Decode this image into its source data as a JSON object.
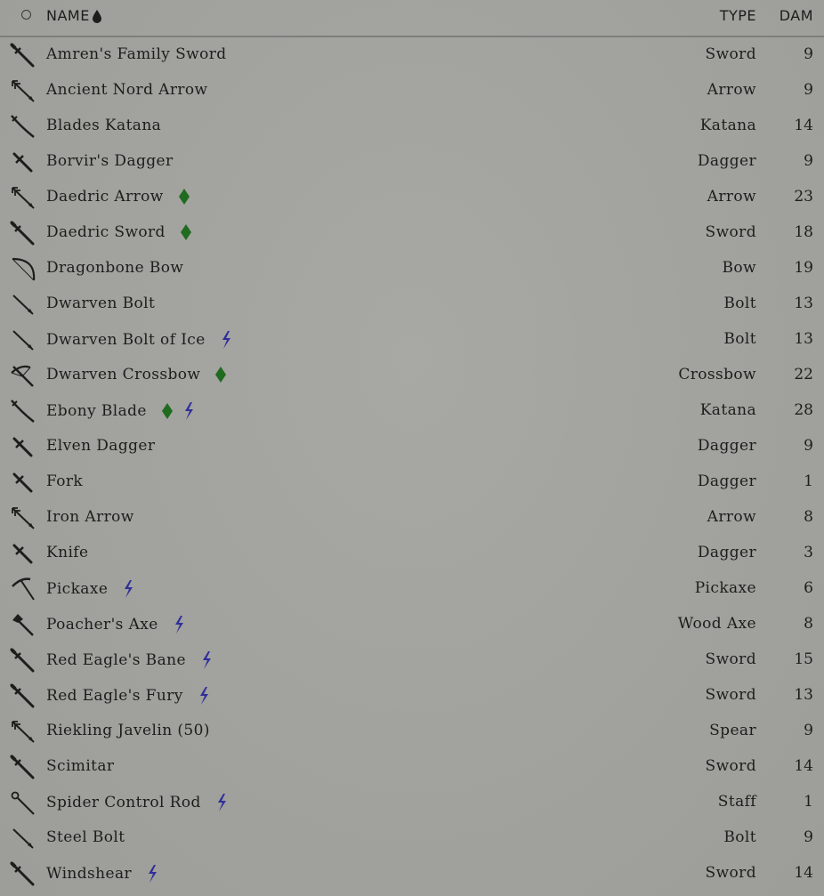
{
  "header": {
    "name_label": "NAME",
    "type_label": "TYPE",
    "dam_label": "DAM",
    "sort_indicator": "drop-sort-icon"
  },
  "colors": {
    "enchanted": "#2f2f9a",
    "stolen_marker": "#1f6b1f",
    "text": "#1d1d1b",
    "background": "#a3a39f"
  },
  "items": [
    {
      "name": "Amren's Family Sword",
      "type": "Sword",
      "dam": "9",
      "icon": "sword-icon",
      "badges": []
    },
    {
      "name": "Ancient Nord Arrow",
      "type": "Arrow",
      "dam": "9",
      "icon": "arrow-icon",
      "badges": []
    },
    {
      "name": "Blades Katana",
      "type": "Katana",
      "dam": "14",
      "icon": "katana-icon",
      "badges": []
    },
    {
      "name": "Borvir's Dagger",
      "type": "Dagger",
      "dam": "9",
      "icon": "dagger-icon",
      "badges": []
    },
    {
      "name": "Daedric Arrow",
      "type": "Arrow",
      "dam": "23",
      "icon": "arrow-icon",
      "badges": [
        "new-diamond-icon"
      ]
    },
    {
      "name": "Daedric Sword",
      "type": "Sword",
      "dam": "18",
      "icon": "sword-icon",
      "badges": [
        "new-diamond-icon"
      ]
    },
    {
      "name": "Dragonbone Bow",
      "type": "Bow",
      "dam": "19",
      "icon": "bow-icon",
      "badges": []
    },
    {
      "name": "Dwarven Bolt",
      "type": "Bolt",
      "dam": "13",
      "icon": "bolt-icon",
      "badges": []
    },
    {
      "name": "Dwarven Bolt of Ice",
      "type": "Bolt",
      "dam": "13",
      "icon": "bolt-icon",
      "badges": [
        "enchanted-icon"
      ]
    },
    {
      "name": "Dwarven Crossbow",
      "type": "Crossbow",
      "dam": "22",
      "icon": "crossbow-icon",
      "badges": [
        "new-diamond-icon"
      ]
    },
    {
      "name": "Ebony Blade",
      "type": "Katana",
      "dam": "28",
      "icon": "katana-icon",
      "badges": [
        "new-diamond-icon",
        "enchanted-icon"
      ]
    },
    {
      "name": "Elven Dagger",
      "type": "Dagger",
      "dam": "9",
      "icon": "dagger-icon",
      "badges": []
    },
    {
      "name": "Fork",
      "type": "Dagger",
      "dam": "1",
      "icon": "dagger-icon",
      "badges": []
    },
    {
      "name": "Iron Arrow",
      "type": "Arrow",
      "dam": "8",
      "icon": "arrow-icon",
      "badges": []
    },
    {
      "name": "Knife",
      "type": "Dagger",
      "dam": "3",
      "icon": "dagger-icon",
      "badges": []
    },
    {
      "name": "Pickaxe",
      "type": "Pickaxe",
      "dam": "6",
      "icon": "pickaxe-icon",
      "badges": [
        "enchanted-icon"
      ]
    },
    {
      "name": "Poacher's Axe",
      "type": "Wood Axe",
      "dam": "8",
      "icon": "axe-icon",
      "badges": [
        "enchanted-icon"
      ]
    },
    {
      "name": "Red Eagle's Bane",
      "type": "Sword",
      "dam": "15",
      "icon": "sword-icon",
      "badges": [
        "enchanted-icon"
      ]
    },
    {
      "name": "Red Eagle's Fury",
      "type": "Sword",
      "dam": "13",
      "icon": "sword-icon",
      "badges": [
        "enchanted-icon"
      ]
    },
    {
      "name": "Riekling Javelin (50)",
      "type": "Spear",
      "dam": "9",
      "icon": "arrow-icon",
      "badges": []
    },
    {
      "name": "Scimitar",
      "type": "Sword",
      "dam": "14",
      "icon": "sword-icon",
      "badges": []
    },
    {
      "name": "Spider Control Rod",
      "type": "Staff",
      "dam": "1",
      "icon": "staff-icon",
      "badges": [
        "enchanted-icon"
      ]
    },
    {
      "name": "Steel Bolt",
      "type": "Bolt",
      "dam": "9",
      "icon": "bolt-icon",
      "badges": []
    },
    {
      "name": "Windshear",
      "type": "Sword",
      "dam": "14",
      "icon": "sword-icon",
      "badges": [
        "enchanted-icon"
      ]
    }
  ]
}
